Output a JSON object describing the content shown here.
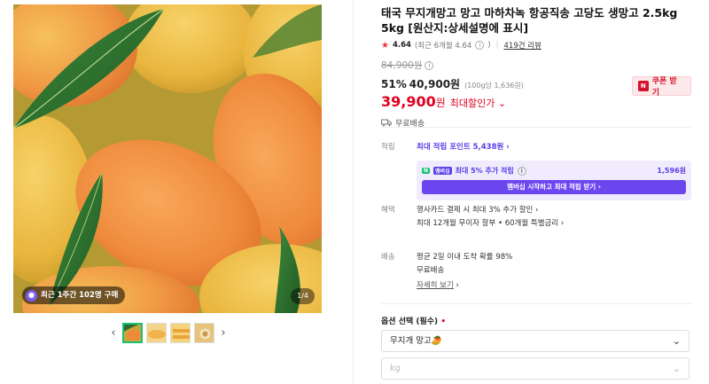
{
  "gallery": {
    "buy_badge": "최근 1주간 102명 구매",
    "page_counter": "1/4",
    "prev_arrow": "‹",
    "next_arrow": "›"
  },
  "product": {
    "title": "태국 무지개망고 망고 마하차녹 항공직송 고당도 생망고 2.5kg 5kg [원산지:상세설명에 표시]",
    "rating_score": "4.64",
    "rating_recent": "(최근 6개월 4.64",
    "rating_recent_close": ")",
    "review_count": "419건 리뷰",
    "original_price": "84,900원",
    "discount_rate": "51%",
    "sale_price": "40,900원",
    "unit_price": "(100g당 1,636원)",
    "final_price": "39,900",
    "final_won": "원",
    "max_discount": "최대할인가",
    "coupon_button": "쿠폰 받기",
    "free_shipping": "무료배송"
  },
  "points": {
    "label": "적립",
    "max_points": "최대 적립 포인트 5,438원",
    "member_badge": "멤버십",
    "member_extra": "최대 5% 추가 적립",
    "member_amount": "1,596원",
    "member_button": "멤버십 시작하고 최대 적립 받기"
  },
  "benefit": {
    "label": "혜택",
    "line1": "행사카드 결제 시 최대 3% 추가 할인",
    "line2": "최대 12개월 무이자 할부 • 60개월 특별금리"
  },
  "delivery": {
    "label": "배송",
    "line1": "평균 2일 이내 도착 확률 98%",
    "line2": "무료배송",
    "detail": "자세히 보기"
  },
  "options": {
    "label": "옵션 선택 (필수)",
    "required_mark": "•",
    "select1": "무지개 망고🥭",
    "select2_placeholder": "kg"
  }
}
